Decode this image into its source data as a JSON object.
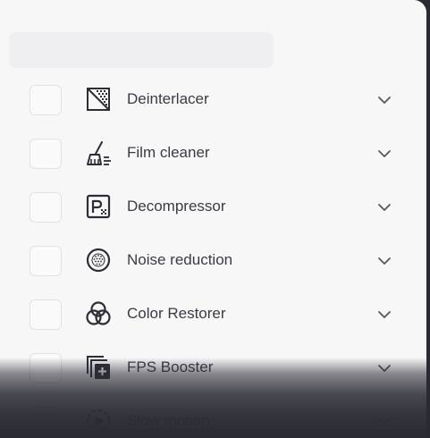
{
  "filters": [
    {
      "label": "Deinterlacer",
      "icon": "deinterlacer-icon",
      "expand_icon": "chevron-down-icon",
      "checked": false
    },
    {
      "label": "Film cleaner",
      "icon": "broom-icon",
      "expand_icon": "chevron-down-icon",
      "checked": false
    },
    {
      "label": "Decompressor",
      "icon": "decompressor-icon",
      "expand_icon": "chevron-down-icon",
      "checked": false
    },
    {
      "label": "Noise reduction",
      "icon": "noise-icon",
      "expand_icon": "chevron-down-icon",
      "checked": false
    },
    {
      "label": "Color Restorer",
      "icon": "color-circles-icon",
      "expand_icon": "chevron-down-icon",
      "checked": false
    },
    {
      "label": "FPS Booster",
      "icon": "fps-booster-icon",
      "expand_icon": "chevron-down-icon",
      "checked": false
    },
    {
      "label": "Slow motion",
      "icon": "slow-motion-icon",
      "expand_icon": "chevron-down-icon",
      "checked": false
    }
  ],
  "colors": {
    "panel_bg": "#f7f7f8",
    "text": "#3b3b43",
    "icon": "#2d2d35",
    "chevron": "#55555e",
    "backdrop": "#2a2a33"
  }
}
